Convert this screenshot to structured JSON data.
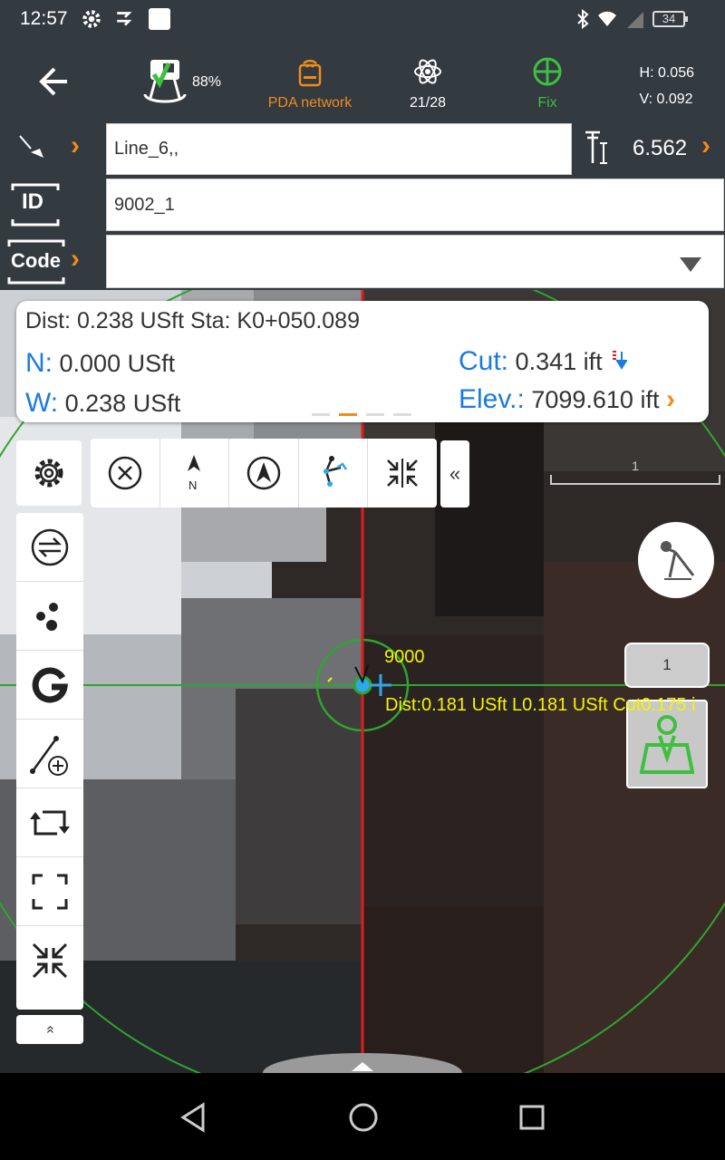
{
  "status_bar": {
    "time": "12:57",
    "battery": "34"
  },
  "toolbar": {
    "device_percent": "88%",
    "network_label": "PDA network",
    "satellites": "21/28",
    "fix_label": "Fix",
    "h_precision": "H: 0.056",
    "v_precision": "V: 0.092",
    "colors": {
      "network": "#f08b1c",
      "fix": "#3fbf3f"
    }
  },
  "line_row": {
    "line_value": "Line_6,,",
    "antenna_height": "6.562"
  },
  "id_row": {
    "label": "ID",
    "value": "9002_1"
  },
  "code_row": {
    "label": "Code",
    "value": ""
  },
  "info_card": {
    "line1": "Dist: 0.238 USft Sta: K0+050.089",
    "n_label": "N:",
    "n_value": "0.000 USft",
    "w_label": "W:",
    "w_value": "0.238 USft",
    "cut_label": "Cut:",
    "cut_value": "0.341 ift",
    "elev_label": "Elev.:",
    "elev_value": "7099.610 ift"
  },
  "map": {
    "scale_label": "1",
    "point_name": "9000",
    "point_dist_text": "Dist:0.181 USft L0.181 USft Cut0.175 i",
    "badge_count": "1",
    "side_expand": "»"
  },
  "top_tools": {
    "collapse": "«"
  }
}
